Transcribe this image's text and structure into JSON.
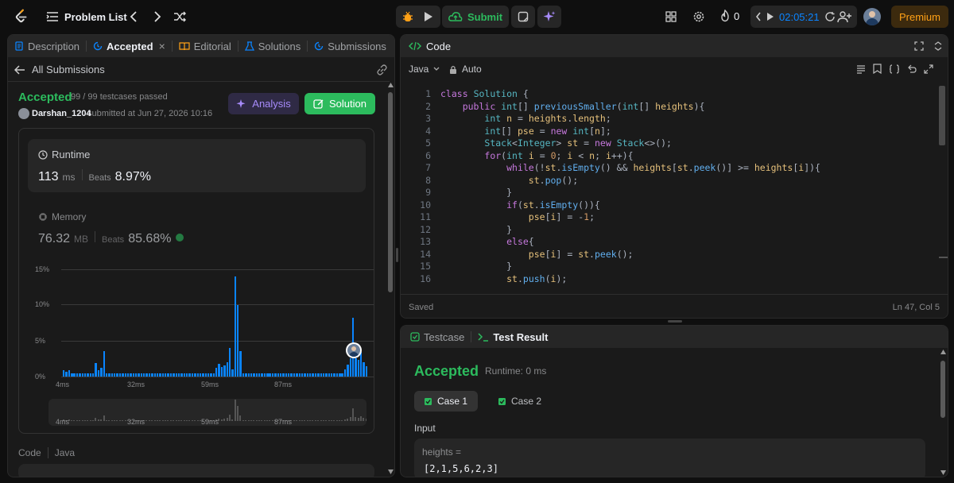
{
  "topbar": {
    "problem_list": "Problem List",
    "submit": "Submit",
    "streak": "0",
    "timer": "02:05:21",
    "premium": "Premium"
  },
  "left_panel": {
    "tabs": [
      {
        "label": "Description"
      },
      {
        "label": "Accepted"
      },
      {
        "label": "Editorial"
      },
      {
        "label": "Solutions"
      },
      {
        "label": "Submissions"
      }
    ],
    "back_label": "All Submissions",
    "status": "Accepted",
    "testcases": "99 / 99 testcases passed",
    "username": "Darshan_1204",
    "submitted_at": "submitted at Jun 27, 2026 10:16",
    "analysis_label": "Analysis",
    "solution_label": "Solution",
    "runtime": {
      "label": "Runtime",
      "value": "113",
      "unit": "ms",
      "beats_label": "Beats",
      "beats_value": "8.97%"
    },
    "memory": {
      "label": "Memory",
      "value": "76.32",
      "unit": "MB",
      "beats_label": "Beats",
      "beats_value": "85.68%"
    },
    "chart_y_ticks": [
      "15%",
      "10%",
      "5%",
      "0%"
    ],
    "chart_x_ticks": [
      "4ms",
      "32ms",
      "59ms",
      "87ms"
    ],
    "code_label": "Code",
    "code_lang": "Java"
  },
  "chart_data": {
    "type": "bar",
    "title": "",
    "xlabel": "",
    "ylabel": "",
    "x_tick_labels": [
      "4ms",
      "32ms",
      "59ms",
      "87ms"
    ],
    "ylim": [
      0,
      15
    ],
    "y_ticks": [
      "0%",
      "5%",
      "10%",
      "15%"
    ],
    "values": [
      0.9,
      0.7,
      0.9,
      0.5,
      0.5,
      0.5,
      0.5,
      0.5,
      0.5,
      0.5,
      0.5,
      0.5,
      1.9,
      0.9,
      1.2,
      3.6,
      0.5,
      0.5,
      0.5,
      0.5,
      0.5,
      0.5,
      0.5,
      0.5,
      0.5,
      0.5,
      0.5,
      0.5,
      0.5,
      0.5,
      0.5,
      0.5,
      0.5,
      0.5,
      0.5,
      0.5,
      0.5,
      0.5,
      0.5,
      0.5,
      0.5,
      0.5,
      0.5,
      0.5,
      0.5,
      0.5,
      0.5,
      0.5,
      0.5,
      0.5,
      0.5,
      0.5,
      0.5,
      0.5,
      0.5,
      0.5,
      0.5,
      1.2,
      1.8,
      1.3,
      1.6,
      2.0,
      4.0,
      1.0,
      14.0,
      10.0,
      3.6,
      0.5,
      0.5,
      0.5,
      0.5,
      0.5,
      0.5,
      0.5,
      0.5,
      0.5,
      0.5,
      0.5,
      0.5,
      0.5,
      0.5,
      0.5,
      0.5,
      0.5,
      0.5,
      0.5,
      0.5,
      0.5,
      0.5,
      0.5,
      0.5,
      0.5,
      0.5,
      0.5,
      0.5,
      0.5,
      0.5,
      0.5,
      0.5,
      0.5,
      0.5,
      0.5,
      0.5,
      0.5,
      0.5,
      1.0,
      1.7,
      2.6,
      8.2,
      2.6,
      2.3,
      3.4,
      2.0,
      1.4
    ],
    "highlight_series": "Beats 8.97%"
  },
  "code_panel": {
    "title": "Code",
    "language": "Java",
    "mode": "Auto",
    "saved": "Saved",
    "cursor": "Ln 47, Col 5",
    "lines": [
      "class Solution {",
      "    public int[] previousSmaller(int[] heights){",
      "        int n = heights.length;",
      "        int[] pse = new int[n];",
      "        Stack<Integer> st = new Stack<>();",
      "        for(int i = 0; i < n; i++){",
      "            while(!st.isEmpty() && heights[st.peek()] >= heights[i]){",
      "                st.pop();",
      "            }",
      "            if(st.isEmpty()){",
      "                pse[i] = -1;",
      "            }",
      "            else{",
      "                pse[i] = st.peek();",
      "            }",
      "            st.push(i);"
    ]
  },
  "result_panel": {
    "tab_testcase": "Testcase",
    "tab_result": "Test Result",
    "status": "Accepted",
    "runtime": "Runtime: 0 ms",
    "cases": [
      "Case 1",
      "Case 2"
    ],
    "input_label": "Input",
    "input_var": "heights =",
    "input_value": "[2,1,5,6,2,3]"
  },
  "colors": {
    "accent_green": "#2cbb5d",
    "bar_blue": "#0a84ff",
    "premium_orange": "#ffa116",
    "analysis_purple": "#a78bfa"
  }
}
